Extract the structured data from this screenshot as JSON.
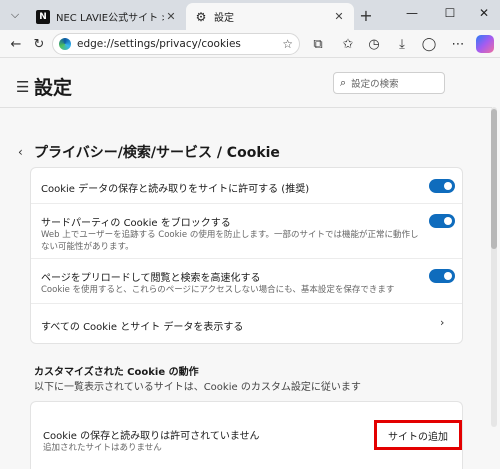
{
  "browser": {
    "tabs": [
      {
        "title": "NEC LAVIE公式サイト > サービス&サポート",
        "active": false,
        "favicon": "nec-favicon"
      },
      {
        "title": "設定",
        "active": true,
        "favicon": "gear-icon"
      }
    ],
    "url": "edge://settings/privacy/cookies"
  },
  "settings": {
    "title": "設定",
    "search_placeholder": "設定の検索",
    "breadcrumb": "プライバシー/検索/サービス  /  Cookie",
    "rows": [
      {
        "label": "Cookie データの保存と読み取りをサイトに許可する (推奨)",
        "desc": "",
        "toggle_on": true
      },
      {
        "label": "サードパーティの Cookie をブロックする",
        "desc": "Web 上でユーザーを追跡する Cookie の使用を防止します。一部のサイトでは機能が正常に動作しない可能性があります。",
        "toggle_on": true
      },
      {
        "label": "ページをプリロードして閲覧と検索を高速化する",
        "desc": "Cookie を使用すると、これらのページにアクセスしない場合にも、基本設定を保存できます",
        "toggle_on": true
      },
      {
        "label": "すべての Cookie とサイト データを表示する",
        "desc": ""
      }
    ],
    "custom": {
      "title": "カスタマイズされた Cookie の動作",
      "subtitle": "以下に一覧表示されているサイトは、Cookie のカスタム設定に従います",
      "block_label": "Cookie の保存と読み取りは許可されていません",
      "block_desc": "追加されたサイトはありません",
      "add_button": "サイトの追加"
    }
  },
  "colors": {
    "accent": "#0f6cbd",
    "highlight": "#e30000"
  }
}
